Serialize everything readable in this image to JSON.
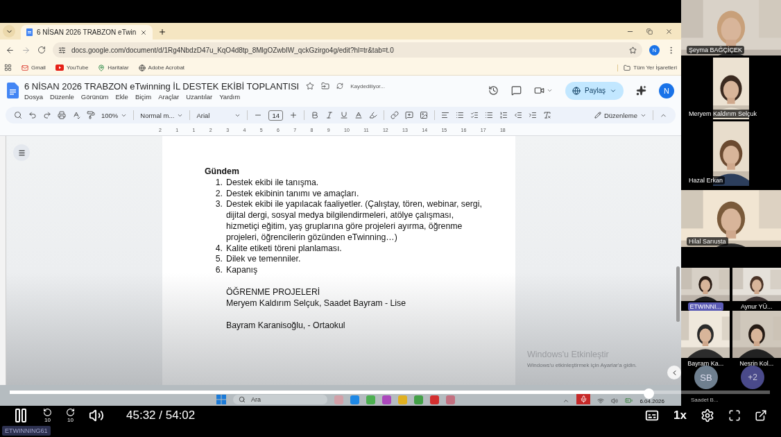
{
  "browser": {
    "tabs": [
      {
        "title": "6 NİSAN 2026 TRABZON eTwin",
        "selected": true
      }
    ],
    "url": "docs.google.com/document/d/1Rg4NbdzD47u_KqO4d8tp_8MlgOZwbIW_qckGzirgo4g/edit?hl=tr&tab=t.0",
    "profile": "N",
    "bookmarks": [
      {
        "label": "Gmail",
        "kind": "mail"
      },
      {
        "label": "YouTube",
        "kind": "video"
      },
      {
        "label": "Haritalar",
        "kind": "map"
      },
      {
        "label": "Adobe Acrobat",
        "kind": "globe"
      }
    ],
    "all_bookmarks": "Tüm Yer İşaretleri"
  },
  "docs": {
    "title": "6 NİSAN 2026 TRABZON eTwinning İL DESTEK EKİBİ TOPLANTISI",
    "save_status": "Kaydediliyor...",
    "menu": [
      "Dosya",
      "Düzenle",
      "Görünüm",
      "Ekle",
      "Biçim",
      "Araçlar",
      "Uzantılar",
      "Yardım"
    ],
    "share": "Paylaş",
    "avatar": "N",
    "toolbar": {
      "zoom": "100%",
      "style": "Normal m...",
      "font": "Arial",
      "size": "14",
      "mode": "Düzenleme"
    },
    "ruler": [
      "2",
      "1",
      "1",
      "2",
      "3",
      "4",
      "5",
      "6",
      "7",
      "8",
      "9",
      "10",
      "11",
      "12",
      "13",
      "14",
      "15",
      "16",
      "17",
      "18"
    ]
  },
  "document": {
    "heading": "Gündem",
    "items": [
      {
        "number": "1.",
        "text": "Destek ekibi ile tanışma."
      },
      {
        "number": "2.",
        "text": "Destek ekibinin tanımı ve amaçları."
      },
      {
        "number": "3.",
        "text": "Destek ekibi ile yapılacak faaliyetler. (Çalıştay, tören, webinar, sergi, dijital dergi, sosyal medya bilgilendirmeleri, atölye çalışması, hizmetiçi eğitim, yaş gruplarına göre projeleri ayırma, öğrenme projeleri, öğrencilerin gözünden eTwinning…)"
      },
      {
        "number": "4.",
        "text": "Kalite etiketi töreni planlaması."
      },
      {
        "number": "5.",
        "text": "Dilek ve temenniler."
      },
      {
        "number": "6.",
        "text": "Kapanış"
      }
    ],
    "section_title": "ÖĞRENME PROJELERİ",
    "lines": [
      "Meryem Kaldırım Selçuk, Saadet Bayram - Lise",
      "Bayram Karanisoğlu,  - Ortaokul"
    ]
  },
  "windows": {
    "activation_title": "Windows'u Etkinleştir",
    "activation_text": "Windows'u etkinleştirmek için Ayarlar'a gidin.",
    "search": "Ara",
    "date": "6.04.2026"
  },
  "participants": [
    {
      "name": "Şeyma BAĞÇİÇEK",
      "kind": "wide",
      "highlighted": false
    },
    {
      "name": "Meryem Kaldırım Selçuk",
      "kind": "narrow",
      "highlighted": false
    },
    {
      "name": "Hazal Erkan",
      "kind": "narrow",
      "highlighted": false
    },
    {
      "name": "Hilal Sarıusta",
      "kind": "wide",
      "highlighted": false
    },
    {
      "name": "ETWINNI...",
      "kind": "half",
      "highlighted": true
    },
    {
      "name": "Aynur YÜ...",
      "kind": "half",
      "highlighted": false
    },
    {
      "name": "Bayram Ka...",
      "kind": "half",
      "highlighted": false
    },
    {
      "name": "Nesrin Kol...",
      "kind": "half",
      "highlighted": false
    }
  ],
  "player": {
    "level": 0.84,
    "time": "45:32 / 54:02",
    "skip_back": "10",
    "skip_forward": "10",
    "speed": "1x",
    "channel": "ETWINNING61",
    "avatar": "SB",
    "avatar_name": "Saadet B...",
    "more": "+2"
  }
}
